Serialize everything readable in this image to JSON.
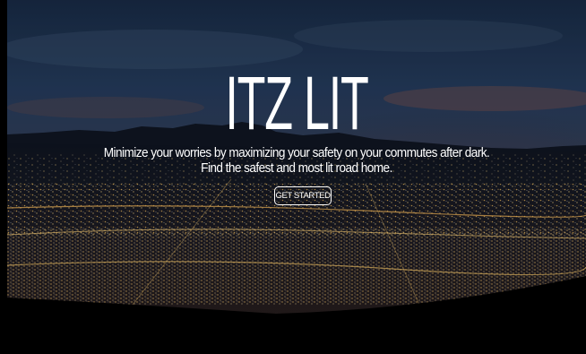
{
  "hero": {
    "title": "ITZ LIT",
    "tagline_line1": "Minimize your worries by maximizing your safety on your commutes after dark.",
    "tagline_line2": "Find the safest and most lit road home.",
    "cta_label": "GET STARTED",
    "background": "night-city-skyline-photo"
  },
  "colors": {
    "text": "#ffffff",
    "sky_top": "#1d2f4a",
    "sky_glow": "#7a4a3a",
    "city_lights": "#f3c96a"
  }
}
